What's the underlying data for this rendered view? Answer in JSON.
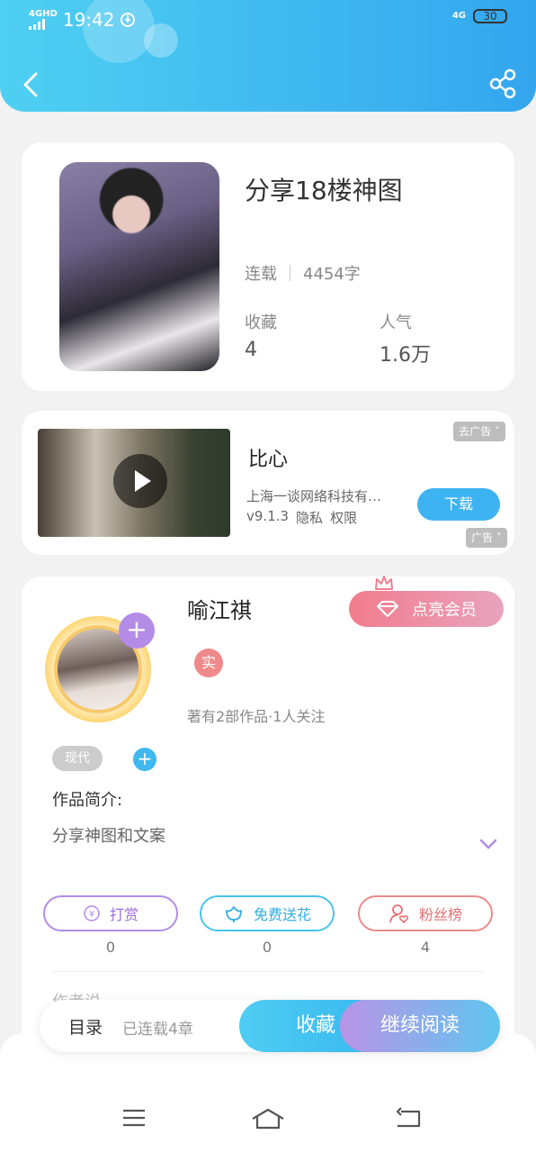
{
  "status_bar": {
    "network": "4GHD",
    "time": "19:42",
    "right_network": "4G",
    "battery": "30"
  },
  "header": {
    "back_icon": "chevron-left-icon",
    "share_icon": "share-icon"
  },
  "book": {
    "title": "分享18楼神图",
    "status": "连载",
    "word_count": "4454字",
    "favorites_label": "收藏",
    "favorites_value": "4",
    "popularity_label": "人气",
    "popularity_value": "1.6万"
  },
  "ad": {
    "name": "比心",
    "company": "上海一谈网络科技有…",
    "version": "v9.1.3",
    "privacy": "隐私",
    "permissions": "权限",
    "download_label": "下载",
    "tag_remove": "去广告",
    "tag_ad": "广告"
  },
  "author": {
    "name": "喻江祺",
    "vip_label": "点亮会员",
    "real_badge": "实",
    "meta": "著有2部作品·1人关注",
    "genre": "现代",
    "intro_label": "作品简介:",
    "intro_text": "分享神图和文案",
    "actions": [
      {
        "label": "打赏",
        "count": "0"
      },
      {
        "label": "免费送花",
        "count": "0"
      },
      {
        "label": "粉丝榜",
        "count": "4"
      }
    ],
    "peek_text": "作者说"
  },
  "bottom": {
    "toc_label": "目录",
    "chapters": "已连载4章",
    "favorite_label": "收藏",
    "read_label": "继续阅读"
  },
  "colors": {
    "header_start": "#4fd0f2",
    "header_end": "#33a6ee",
    "accent_blue": "#3db3f2",
    "accent_purple": "#b48ce8",
    "accent_red": "#ee8a8a"
  }
}
